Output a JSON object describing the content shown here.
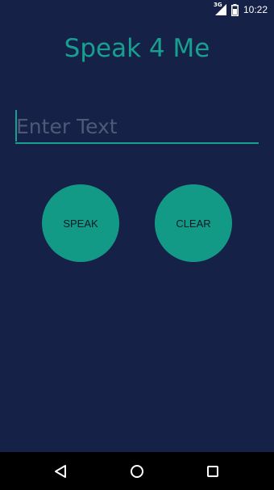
{
  "status_bar": {
    "network_type": "3G",
    "time": "10:22",
    "icons": [
      "signal-icon",
      "battery-icon"
    ]
  },
  "app": {
    "title": "Speak 4 Me"
  },
  "input": {
    "value": "",
    "placeholder": "Enter Text"
  },
  "buttons": {
    "speak_label": "SPEAK",
    "clear_label": "CLEAR"
  },
  "nav_bar": {
    "icons": [
      "back-icon",
      "home-icon",
      "recents-icon"
    ]
  },
  "colors": {
    "background": "#162147",
    "accent": "#17a08f",
    "button_fill": "#139a87",
    "button_text": "#0b1a25",
    "placeholder": "#4f5876",
    "nav_bar": "#000000"
  }
}
